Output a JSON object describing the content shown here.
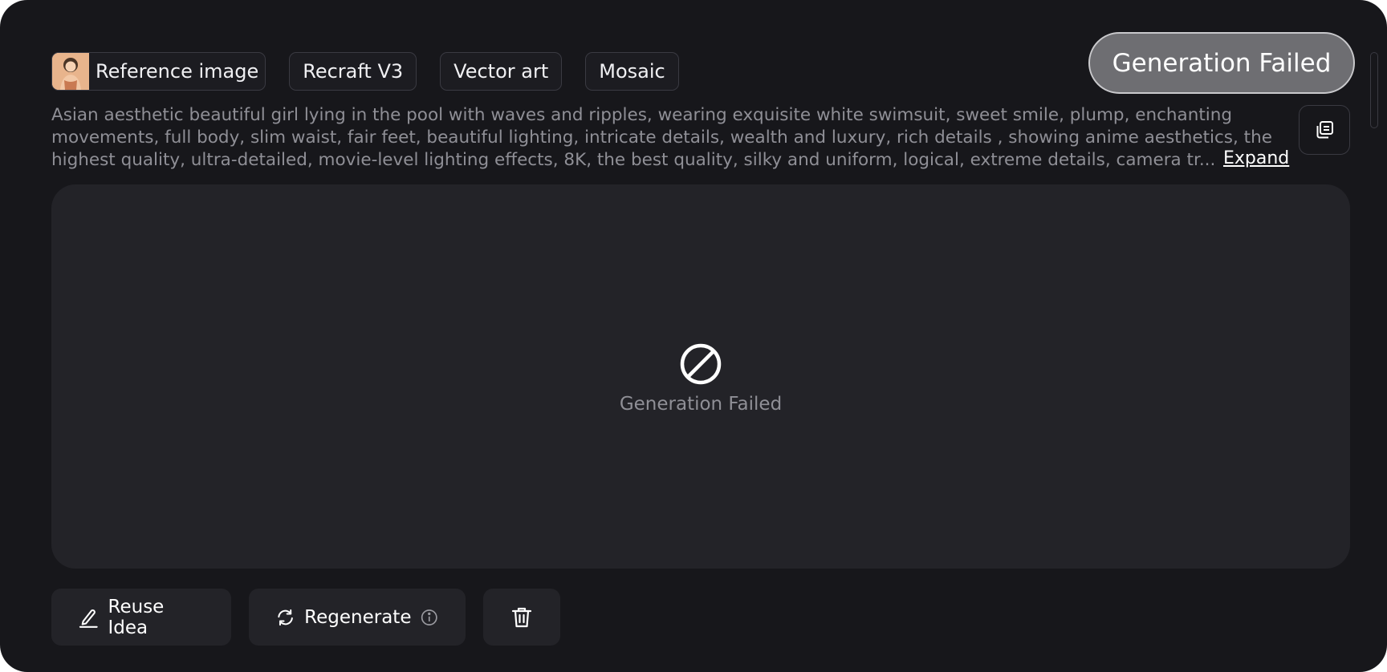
{
  "chips": [
    {
      "label": "Reference image",
      "has_thumbnail": true
    },
    {
      "label": "Recraft V3"
    },
    {
      "label": "Vector art"
    },
    {
      "label": "Mosaic"
    }
  ],
  "status_pill": "Generation Failed",
  "prompt": {
    "text": "Asian aesthetic beautiful girl lying in the pool with waves and ripples, wearing exquisite white swimsuit, sweet smile, plump, enchanting movements, full body, slim waist, fair feet, beautiful lighting, intricate details, wealth and luxury, rich details , showing anime aesthetics, the highest quality, ultra-detailed, movie-level lighting effects, 8K, the best quality, silky and uniform, logical, extreme details, camera tr...",
    "expand_label": "Expand"
  },
  "result": {
    "status_text": "Generation Failed",
    "icon": "prohibited-icon"
  },
  "actions": {
    "reuse_label": "Reuse Idea",
    "regenerate_label": "Regenerate",
    "delete_icon": "trash-icon"
  },
  "colors": {
    "background": "#17171b",
    "panel": "#232328",
    "muted_text": "#8f8f96",
    "pill": "#6e6e72"
  }
}
